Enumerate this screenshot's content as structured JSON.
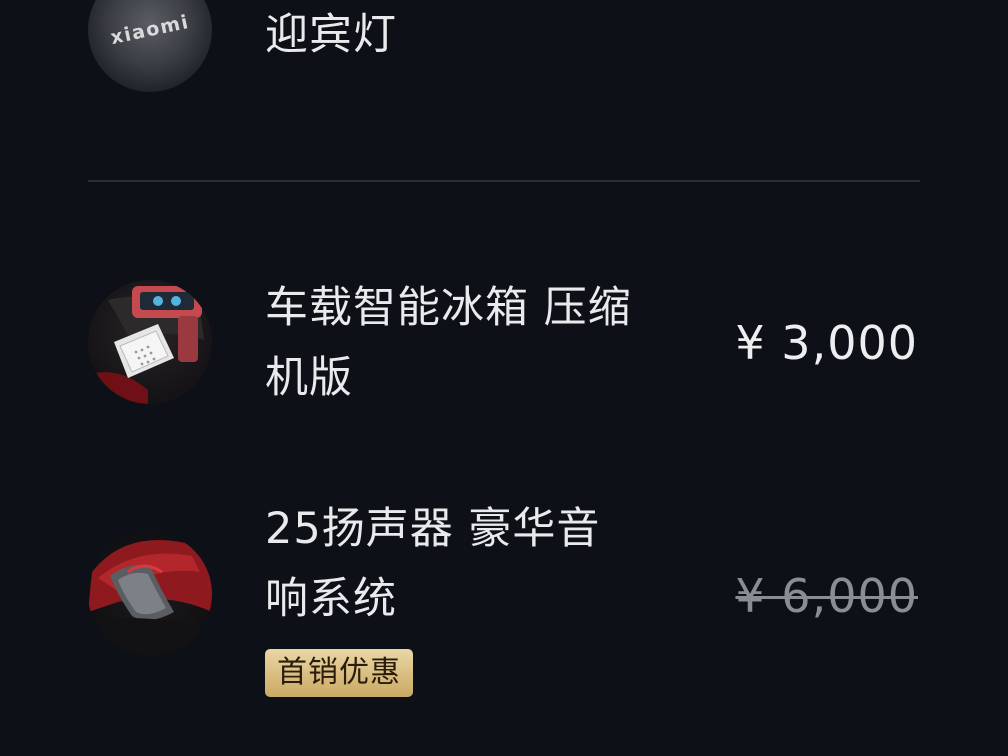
{
  "items": [
    {
      "title": "迎宾灯",
      "thumb_icon": "xiaomi-logo-projection",
      "thumb_text": "xiaomi"
    },
    {
      "title_line1": "车载智能冰箱 压缩",
      "title_line2": "机版",
      "price": "¥ 3,000",
      "thumb_icon": "car-fridge-image"
    },
    {
      "title_line1": "25扬声器 豪华音",
      "title_line2": "响系统",
      "price": "¥ 6,000",
      "price_struck": true,
      "badge": "首销优惠",
      "thumb_icon": "red-speaker-door-image"
    }
  ],
  "colors": {
    "background": "#0d1016",
    "text": "#e9eaec",
    "struck_price": "#8a8d93",
    "badge_gold": "#d9bd80",
    "divider": "#2a2d33"
  }
}
